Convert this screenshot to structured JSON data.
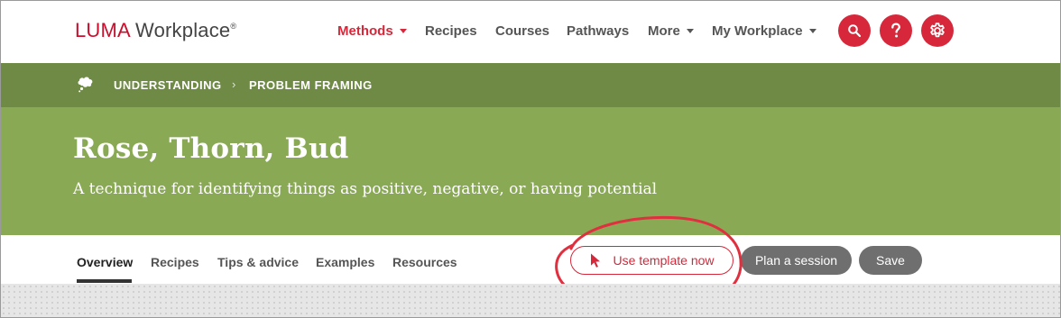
{
  "brand": {
    "luma": "LUMA",
    "workplace": "Workplace",
    "reg": "®"
  },
  "nav": {
    "items": [
      {
        "label": "Methods",
        "active": true,
        "dropdown": true
      },
      {
        "label": "Recipes",
        "active": false,
        "dropdown": false
      },
      {
        "label": "Courses",
        "active": false,
        "dropdown": false
      },
      {
        "label": "Pathways",
        "active": false,
        "dropdown": false
      },
      {
        "label": "More",
        "active": false,
        "dropdown": true
      },
      {
        "label": "My Workplace",
        "active": false,
        "dropdown": true
      }
    ],
    "icons": [
      "search-icon",
      "help-icon",
      "gear-icon"
    ],
    "accent": "#d6283a"
  },
  "breadcrumb": {
    "icon": "thought-cloud-icon",
    "items": [
      "UNDERSTANDING",
      "PROBLEM FRAMING"
    ],
    "separator": "›"
  },
  "hero": {
    "title": "Rose, Thorn, Bud",
    "subtitle": "A technique for identifying things as positive, negative, or having potential"
  },
  "tabs": [
    {
      "label": "Overview",
      "active": true
    },
    {
      "label": "Recipes",
      "active": false
    },
    {
      "label": "Tips & advice",
      "active": false
    },
    {
      "label": "Examples",
      "active": false
    },
    {
      "label": "Resources",
      "active": false
    }
  ],
  "actions": {
    "use_template": "Use template now",
    "plan_session": "Plan a session",
    "save": "Save"
  },
  "colors": {
    "crumb_band": "#6e8a45",
    "hero": "#8aa955",
    "brand_red": "#d6283a",
    "button_gray": "#6f6f6f"
  }
}
